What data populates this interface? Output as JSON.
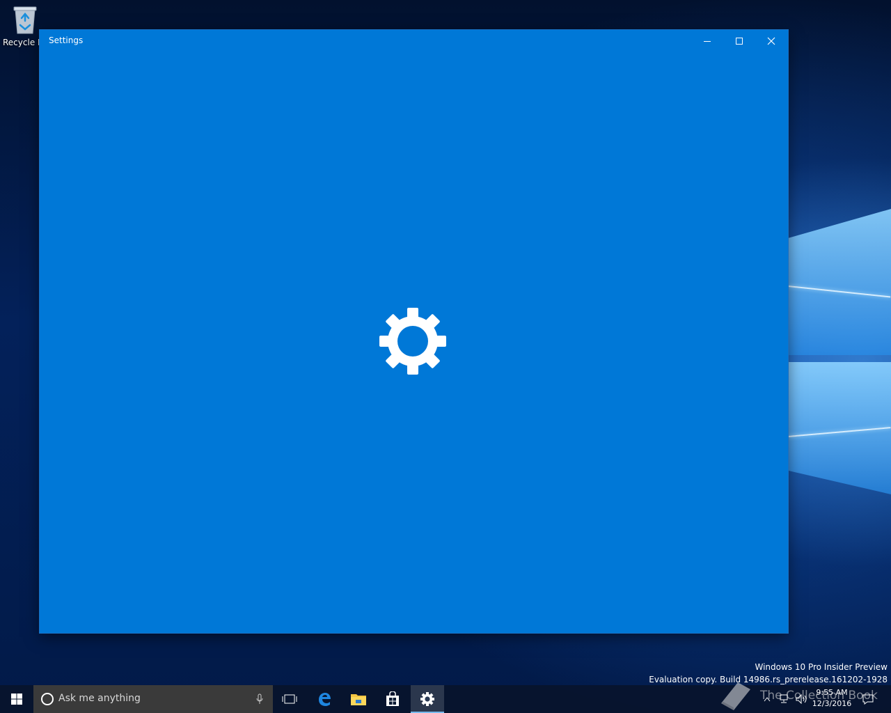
{
  "desktop": {
    "icons": [
      {
        "label": "Recycle Bin",
        "icon": "recycle-bin-icon"
      }
    ],
    "watermark": {
      "line1": "Windows 10 Pro Insider Preview",
      "line2": "Evaluation copy. Build 14986.rs_prerelease.161202-1928"
    },
    "overlay_text": "The Collection Book"
  },
  "window": {
    "title": "Settings",
    "background": "#0078d7",
    "splash_icon": "gear-icon",
    "controls": {
      "minimize": "minimize-icon",
      "maximize": "maximize-icon",
      "close": "close-icon"
    }
  },
  "taskbar": {
    "start_icon": "windows-logo-icon",
    "search": {
      "placeholder": "Ask me anything",
      "icon": "cortana-icon",
      "mic_icon": "microphone-icon"
    },
    "apps": [
      {
        "name": "Task View",
        "icon": "task-view-icon"
      },
      {
        "name": "Microsoft Edge",
        "icon": "edge-icon"
      },
      {
        "name": "File Explorer",
        "icon": "folder-icon"
      },
      {
        "name": "Store",
        "icon": "store-icon"
      },
      {
        "name": "Settings",
        "icon": "gear-icon",
        "active": true
      }
    ],
    "tray": {
      "time": "9:55 AM",
      "date": "12/3/2016",
      "icons": [
        "chevron-up-icon",
        "network-icon",
        "volume-icon",
        "action-center-icon"
      ]
    }
  }
}
